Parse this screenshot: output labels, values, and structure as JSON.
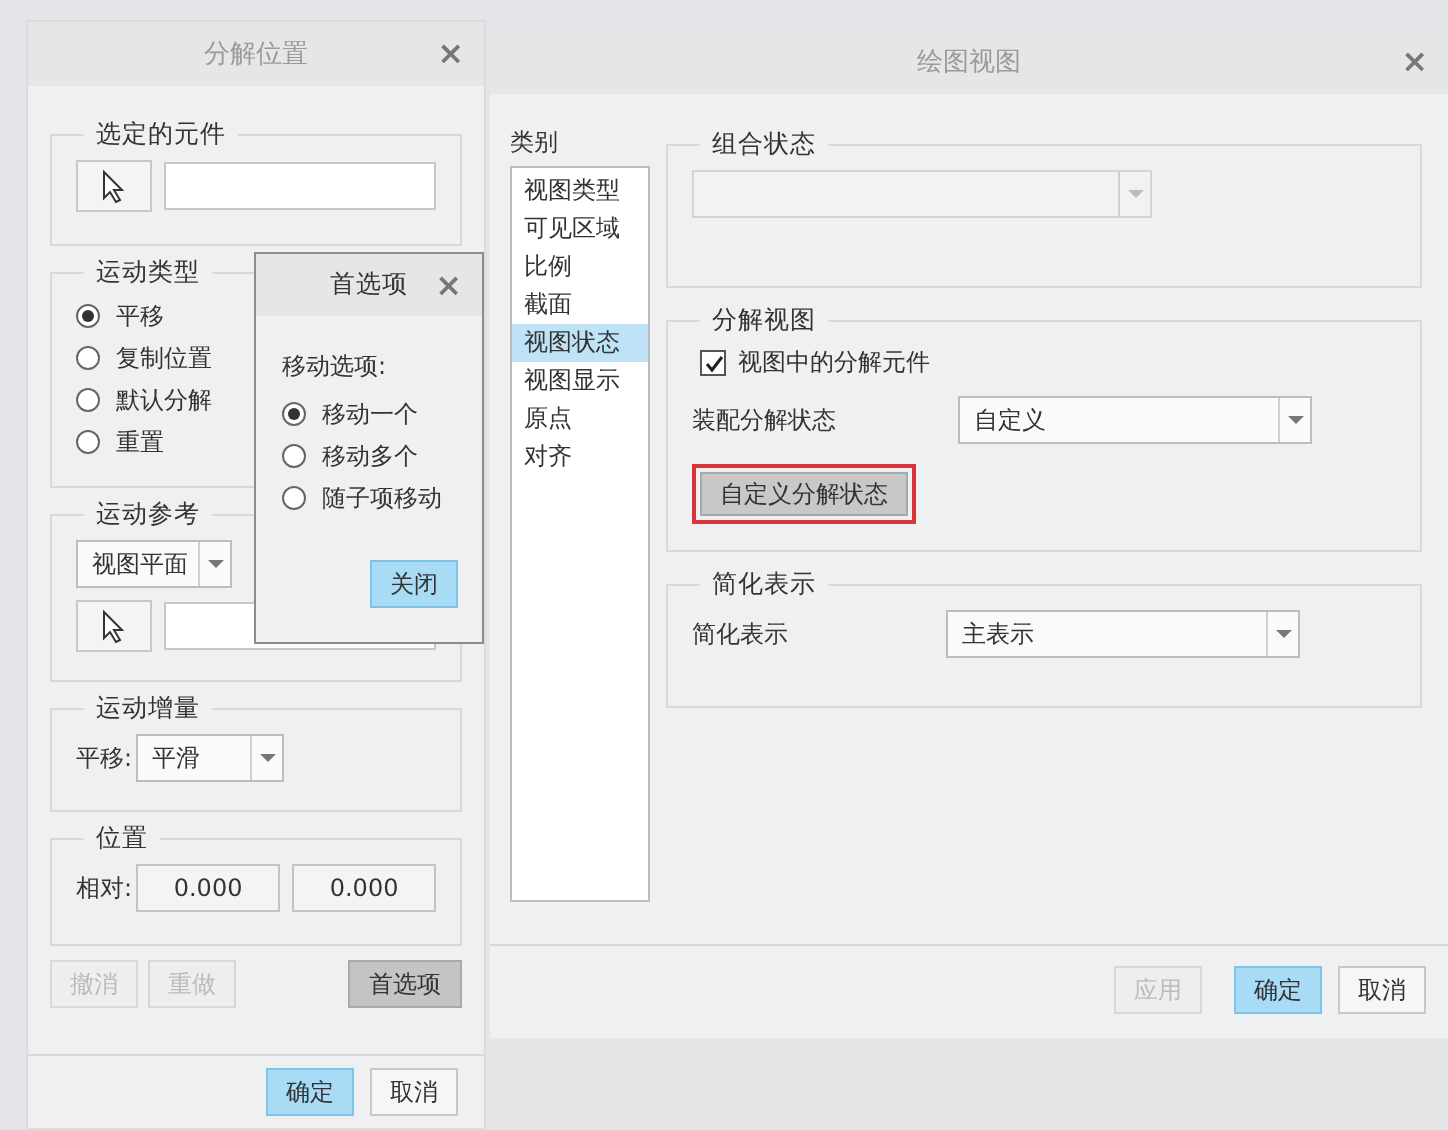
{
  "explode_dialog": {
    "title": "分解位置",
    "close": "×",
    "selected_component": {
      "label": "选定的元件"
    },
    "motion_type": {
      "label": "运动类型",
      "options": [
        {
          "label": "平移",
          "selected": true
        },
        {
          "label": "复制位置",
          "selected": false
        },
        {
          "label": "默认分解",
          "selected": false
        },
        {
          "label": "重置",
          "selected": false
        }
      ]
    },
    "motion_reference": {
      "label": "运动参考",
      "dropdown": "视图平面"
    },
    "motion_increment": {
      "label": "运动增量",
      "field_label": "平移:",
      "dropdown": "平滑"
    },
    "position": {
      "label": "位置",
      "field_label": "相对:",
      "values": [
        "0.000",
        "0.000"
      ]
    },
    "actions": [
      {
        "label": "撤消",
        "disabled": true,
        "pressed": false
      },
      {
        "label": "重做",
        "disabled": true,
        "pressed": false
      },
      {
        "label": "首选项",
        "disabled": false,
        "pressed": true
      }
    ],
    "buttons": [
      {
        "label": "确定",
        "default": true
      },
      {
        "label": "取消",
        "default": false
      }
    ]
  },
  "preferences_popup": {
    "title": "首选项",
    "close": "×",
    "group_label": "移动选项:",
    "options": [
      {
        "label": "移动一个",
        "selected": true
      },
      {
        "label": "移动多个",
        "selected": false
      },
      {
        "label": "随子项移动",
        "selected": false
      }
    ],
    "close_button": "关闭"
  },
  "drawing_view_dialog": {
    "title": "绘图视图",
    "close": "×",
    "category_label": "类别",
    "categories": [
      {
        "label": "视图类型",
        "selected": false
      },
      {
        "label": "可见区域",
        "selected": false
      },
      {
        "label": "比例",
        "selected": false
      },
      {
        "label": "截面",
        "selected": false
      },
      {
        "label": "视图状态",
        "selected": true
      },
      {
        "label": "视图显示",
        "selected": false
      },
      {
        "label": "原点",
        "selected": false
      },
      {
        "label": "对齐",
        "selected": false
      }
    ],
    "combined_state": {
      "label": "组合状态",
      "disabled": true
    },
    "exploded_view": {
      "label": "分解视图",
      "checkbox": {
        "label": "视图中的分解元件",
        "checked": true
      },
      "field_label": "装配分解状态",
      "dropdown": "自定义",
      "button": {
        "label": "自定义分解状态",
        "highlighted": true
      }
    },
    "simplified_rep": {
      "label": "简化表示",
      "field_label": "简化表示",
      "dropdown": "主表示"
    },
    "buttons": [
      {
        "label": "应用",
        "disabled": true,
        "default": false
      },
      {
        "label": "确定",
        "disabled": false,
        "default": true
      },
      {
        "label": "取消",
        "disabled": false,
        "default": false
      }
    ]
  }
}
